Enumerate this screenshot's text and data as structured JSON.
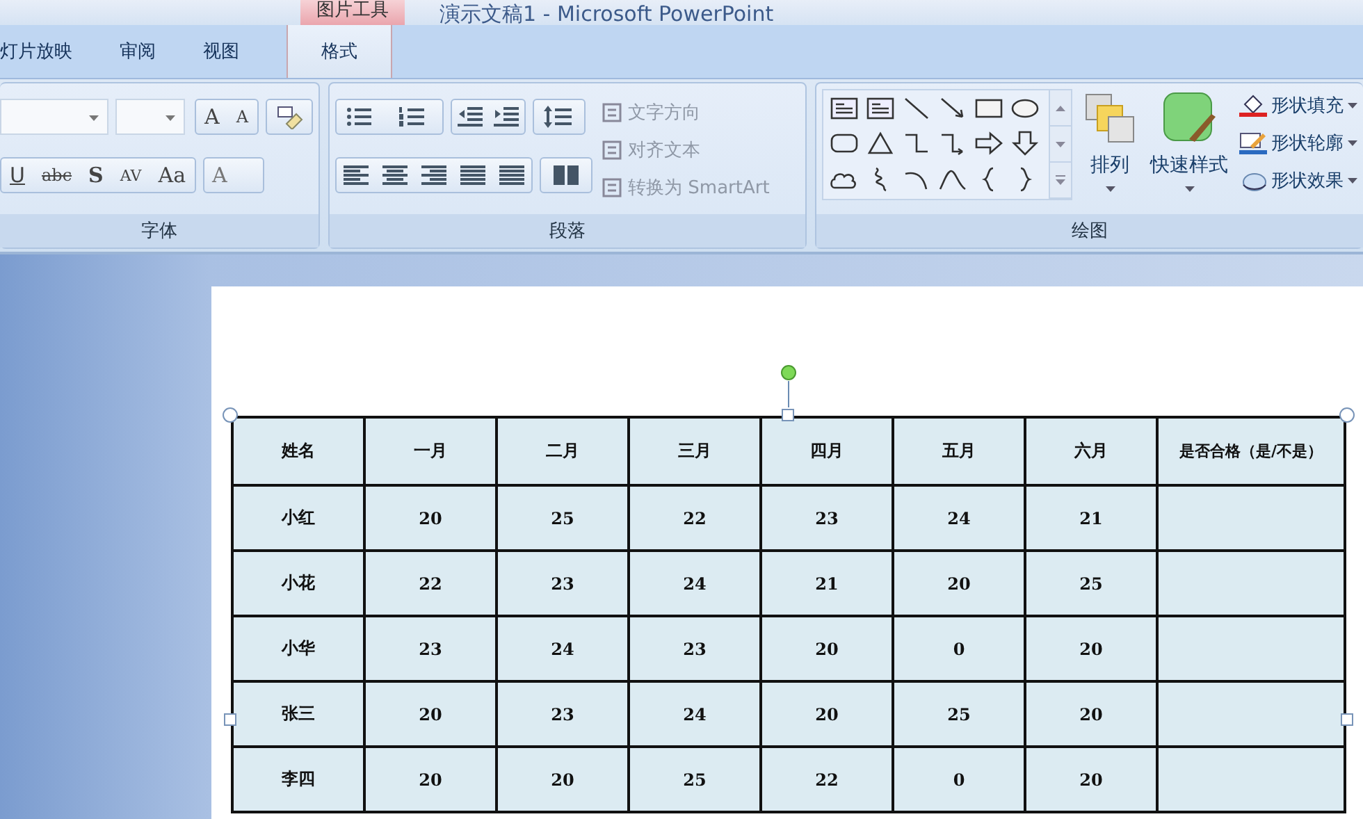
{
  "title_bar": {
    "context_tab": "图片工具",
    "title": "演示文稿1 - Microsoft PowerPoint"
  },
  "tabs": [
    {
      "label": "灯片放映",
      "selected": false
    },
    {
      "label": "审阅",
      "selected": false
    },
    {
      "label": "视图",
      "selected": false
    },
    {
      "label": "格式",
      "selected": true
    }
  ],
  "font_group": {
    "label": "字体",
    "size_buttons": [
      "A",
      "A"
    ],
    "format_buttons": [
      "U",
      "abc",
      "S",
      "AV",
      "Aa"
    ],
    "color_button": "A"
  },
  "paragraph_group": {
    "label": "段落",
    "commands": [
      {
        "label": "文字方向",
        "disabled": true
      },
      {
        "label": "对齐文本",
        "disabled": true
      },
      {
        "label": "转换为 SmartArt",
        "disabled": true
      }
    ]
  },
  "drawing_group": {
    "label": "绘图",
    "arrange": "排列",
    "quick_styles": "快速样式",
    "commands": [
      "形状填充",
      "形状轮廓",
      "形状效果"
    ]
  },
  "table": {
    "columns": [
      "姓名",
      "一月",
      "二月",
      "三月",
      "四月",
      "五月",
      "六月",
      "是否合格（是/不是）"
    ],
    "rows": [
      [
        "小红",
        "20",
        "25",
        "22",
        "23",
        "24",
        "21",
        ""
      ],
      [
        "小花",
        "22",
        "23",
        "24",
        "21",
        "20",
        "25",
        ""
      ],
      [
        "小华",
        "23",
        "24",
        "23",
        "20",
        "0",
        "20",
        ""
      ],
      [
        "张三",
        "20",
        "23",
        "24",
        "20",
        "25",
        "20",
        ""
      ],
      [
        "李四",
        "20",
        "20",
        "25",
        "22",
        "0",
        "20",
        ""
      ]
    ]
  }
}
